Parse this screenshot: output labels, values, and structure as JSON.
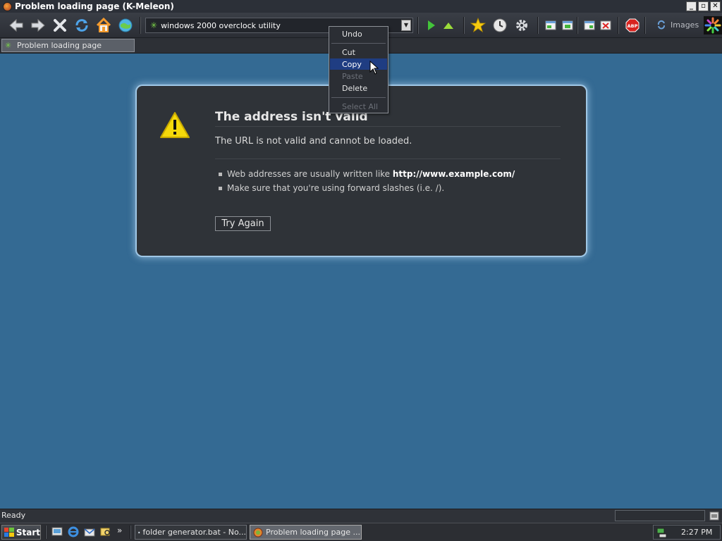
{
  "window": {
    "title": "Problem loading page (K-Meleon)",
    "min": "_",
    "max": "▫",
    "close": "✕"
  },
  "toolbar": {
    "url_value": "windows 2000 overclock utility",
    "images_label": "Images",
    "abp_label": "ABP"
  },
  "tab": {
    "label": "Problem loading page"
  },
  "error": {
    "title": "The address isn't valid",
    "description": "The URL is not valid and cannot be loaded.",
    "bullet1_text": "Web addresses are usually written like ",
    "bullet1_bold": "http://www.example.com/",
    "bullet2_text": "Make sure that you're using forward slashes (i.e. /).",
    "try_again": "Try Again"
  },
  "context_menu": {
    "undo": "Undo",
    "cut": "Cut",
    "copy": "Copy",
    "paste": "Paste",
    "delete": "Delete",
    "select_all": "Select All"
  },
  "status": {
    "text": "Ready"
  },
  "taskbar": {
    "start": "Start",
    "chevron": "»",
    "task1": "folder generator.bat - No...",
    "task2": "Problem loading page ...",
    "clock": "2:27 PM"
  },
  "colors": {
    "desktop_bg": "#346a93",
    "menu_highlight": "#1f3d82",
    "warning_yellow": "#f5d90a"
  }
}
